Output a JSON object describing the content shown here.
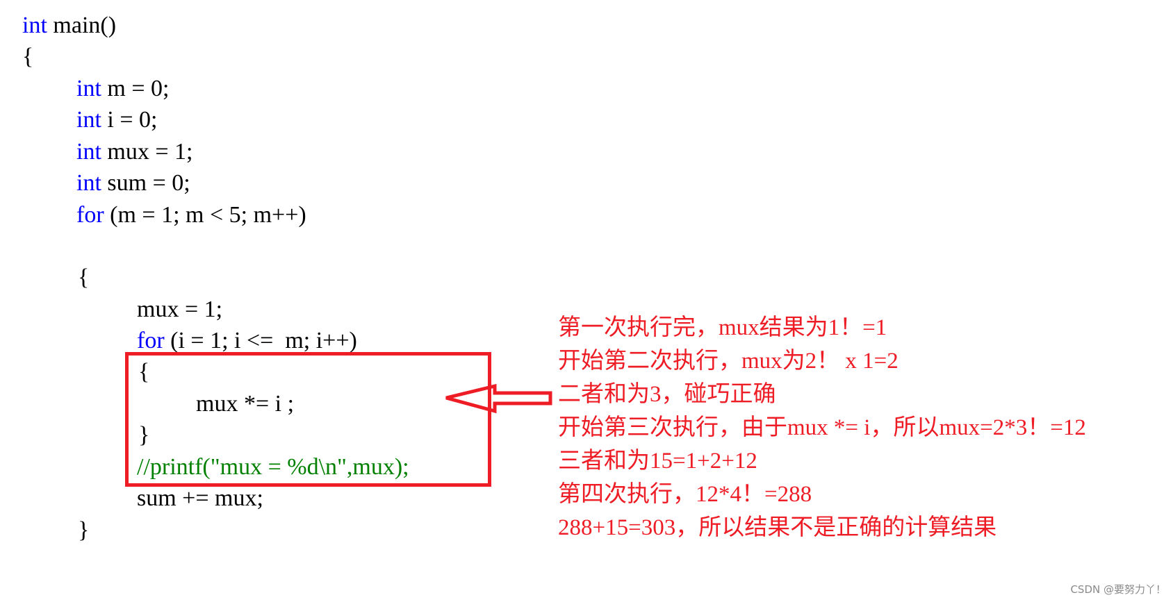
{
  "code": {
    "lines": [
      {
        "kw": "int",
        "rest": " main()"
      },
      {
        "kw": "",
        "rest": "{"
      },
      {
        "kw": "int",
        "rest": " m = 0;"
      },
      {
        "kw": "int",
        "rest": " i = 0;"
      },
      {
        "kw": "int",
        "rest": " mux = 1;"
      },
      {
        "kw": "int",
        "rest": " sum = 0;"
      },
      {
        "kw": "for",
        "rest": " (m = 1; m < 5; m++)"
      },
      {
        "kw": "",
        "rest": "{"
      },
      {
        "kw": "",
        "rest": "mux = 1;"
      },
      {
        "kw": "for",
        "rest": " (i = 1; i <=  m; i++)"
      },
      {
        "kw": "",
        "rest": "{"
      },
      {
        "kw": "",
        "rest": "mux *= i ;"
      },
      {
        "kw": "",
        "rest": "}"
      },
      {
        "comment": "//printf(\"mux = %d\\n\",mux);"
      },
      {
        "kw": "",
        "rest": "sum += mux;"
      },
      {
        "kw": "",
        "rest": "}"
      }
    ]
  },
  "annotation": {
    "lines": [
      "第一次执行完，mux结果为1！=1",
      "开始第二次执行，mux为2！ x 1=2",
      "二者和为3，碰巧正确",
      "开始第三次执行，由于mux *= i，所以mux=2*3！=12",
      "三者和为15=1+2+12",
      "第四次执行，12*4！=288",
      "288+15=303，所以结果不是正确的计算结果"
    ],
    "color": "#ee1c25"
  },
  "highlight": {
    "color": "#ee1c25",
    "arrow_icon": "left-arrow-icon"
  },
  "watermark": "CSDN @要努力丫！",
  "colors": {
    "keyword": "#0000ff",
    "comment": "#008000",
    "text": "#000000"
  }
}
